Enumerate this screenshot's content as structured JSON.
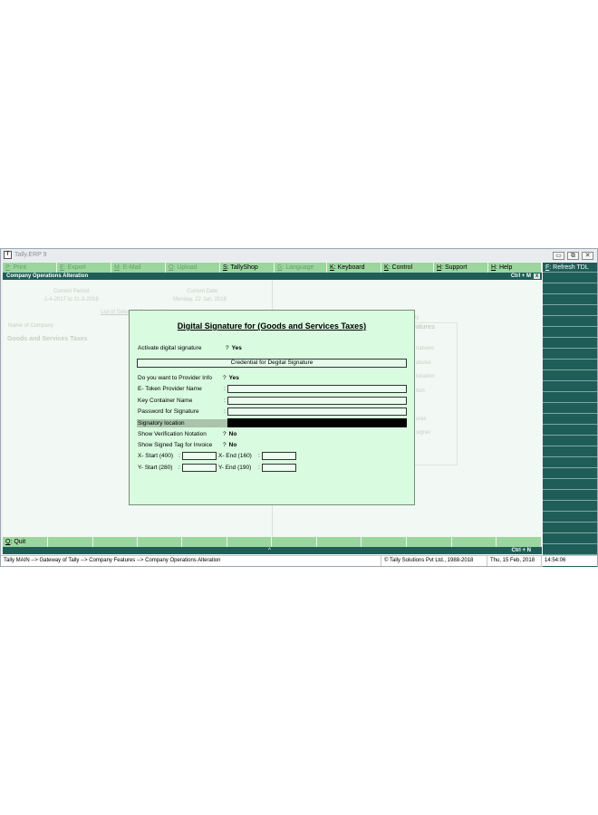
{
  "window": {
    "title": "Tally.ERP 9",
    "icon_label": "T"
  },
  "window_controls": {
    "minimize_icon": "▭",
    "restore_icon": "⧉",
    "close_icon": "✕"
  },
  "menu": [
    {
      "key": "P",
      "label": ": Print",
      "enabled": false
    },
    {
      "key": "E",
      "label": ": Export",
      "enabled": false
    },
    {
      "key": "M",
      "label": ": E-Mail",
      "enabled": false
    },
    {
      "key": "O",
      "label": ": Upload",
      "enabled": false
    },
    {
      "key": "S",
      "label": ": TallyShop",
      "enabled": true
    },
    {
      "key": "G",
      "label": ": Language",
      "enabled": false
    },
    {
      "key": "K",
      "label": ": Keyboard",
      "enabled": true
    },
    {
      "key": "K",
      "label": ": Control Centre",
      "enabled": true
    },
    {
      "key": "H",
      "label": ": Support Centre",
      "enabled": true
    },
    {
      "key": "H",
      "label": ": Help",
      "enabled": true
    }
  ],
  "header": {
    "title": "Company Operations  Alteration",
    "shortcut": "Ctrl + M",
    "close": "x"
  },
  "background": {
    "current_period_label": "Current Period",
    "current_period_value": "1-4-2017 to 31-3-2018",
    "current_date_label": "Current Date",
    "current_date_value": "Monday, 22 Jan, 2018",
    "list_heading": "List of Selected Companies",
    "name_of_company_label": "Name of Company",
    "company_name": "Goods and Services Taxes",
    "right_fragments": [
      "ly",
      "eatures",
      "natures",
      "atures",
      "location",
      "tion",
      "ures",
      "signer"
    ]
  },
  "dialog": {
    "title": "Digital Signature for (Goods and Services Taxes)",
    "activate_label": "Activate digital signature",
    "activate_value": "Yes",
    "credential_bar": "Credential for Degital Signature",
    "provider_info_label": "Do you want to Provider Info",
    "provider_info_value": "Yes",
    "etoken_label": "E- Token Provider Name",
    "key_container_label": "Key Container Name",
    "password_label": "Password for Signature",
    "signatory_label": "Signatory location",
    "verification_label": "Show Verification Notation",
    "verification_value": "No",
    "signed_tag_label": "Show Signed Tag for Invoice",
    "signed_tag_value": "No",
    "x_start_label": "X- Start (400)",
    "x_end_label": "X- End (160)",
    "y_start_label": "Y- Start (280)",
    "y_end_label": "Y- End (190)",
    "question_mark": "?",
    "colon": ":"
  },
  "right_panel": {
    "first_key": "F",
    "first_label": ": Refresh TDL"
  },
  "bottom_bar": {
    "quit_key": "Q",
    "quit_label": ": Quit"
  },
  "strip": {
    "caret": "^",
    "shortcut": "Ctrl + N"
  },
  "status": {
    "path": "Tally MAIN --> Gateway of Tally --> Company Features --> Company Operations  Alteration",
    "copyright": "© Tally Solutions Pvt Ltd., 1988-2018",
    "date": "Thu, 15 Feb, 2018",
    "time": "14:54:06"
  }
}
